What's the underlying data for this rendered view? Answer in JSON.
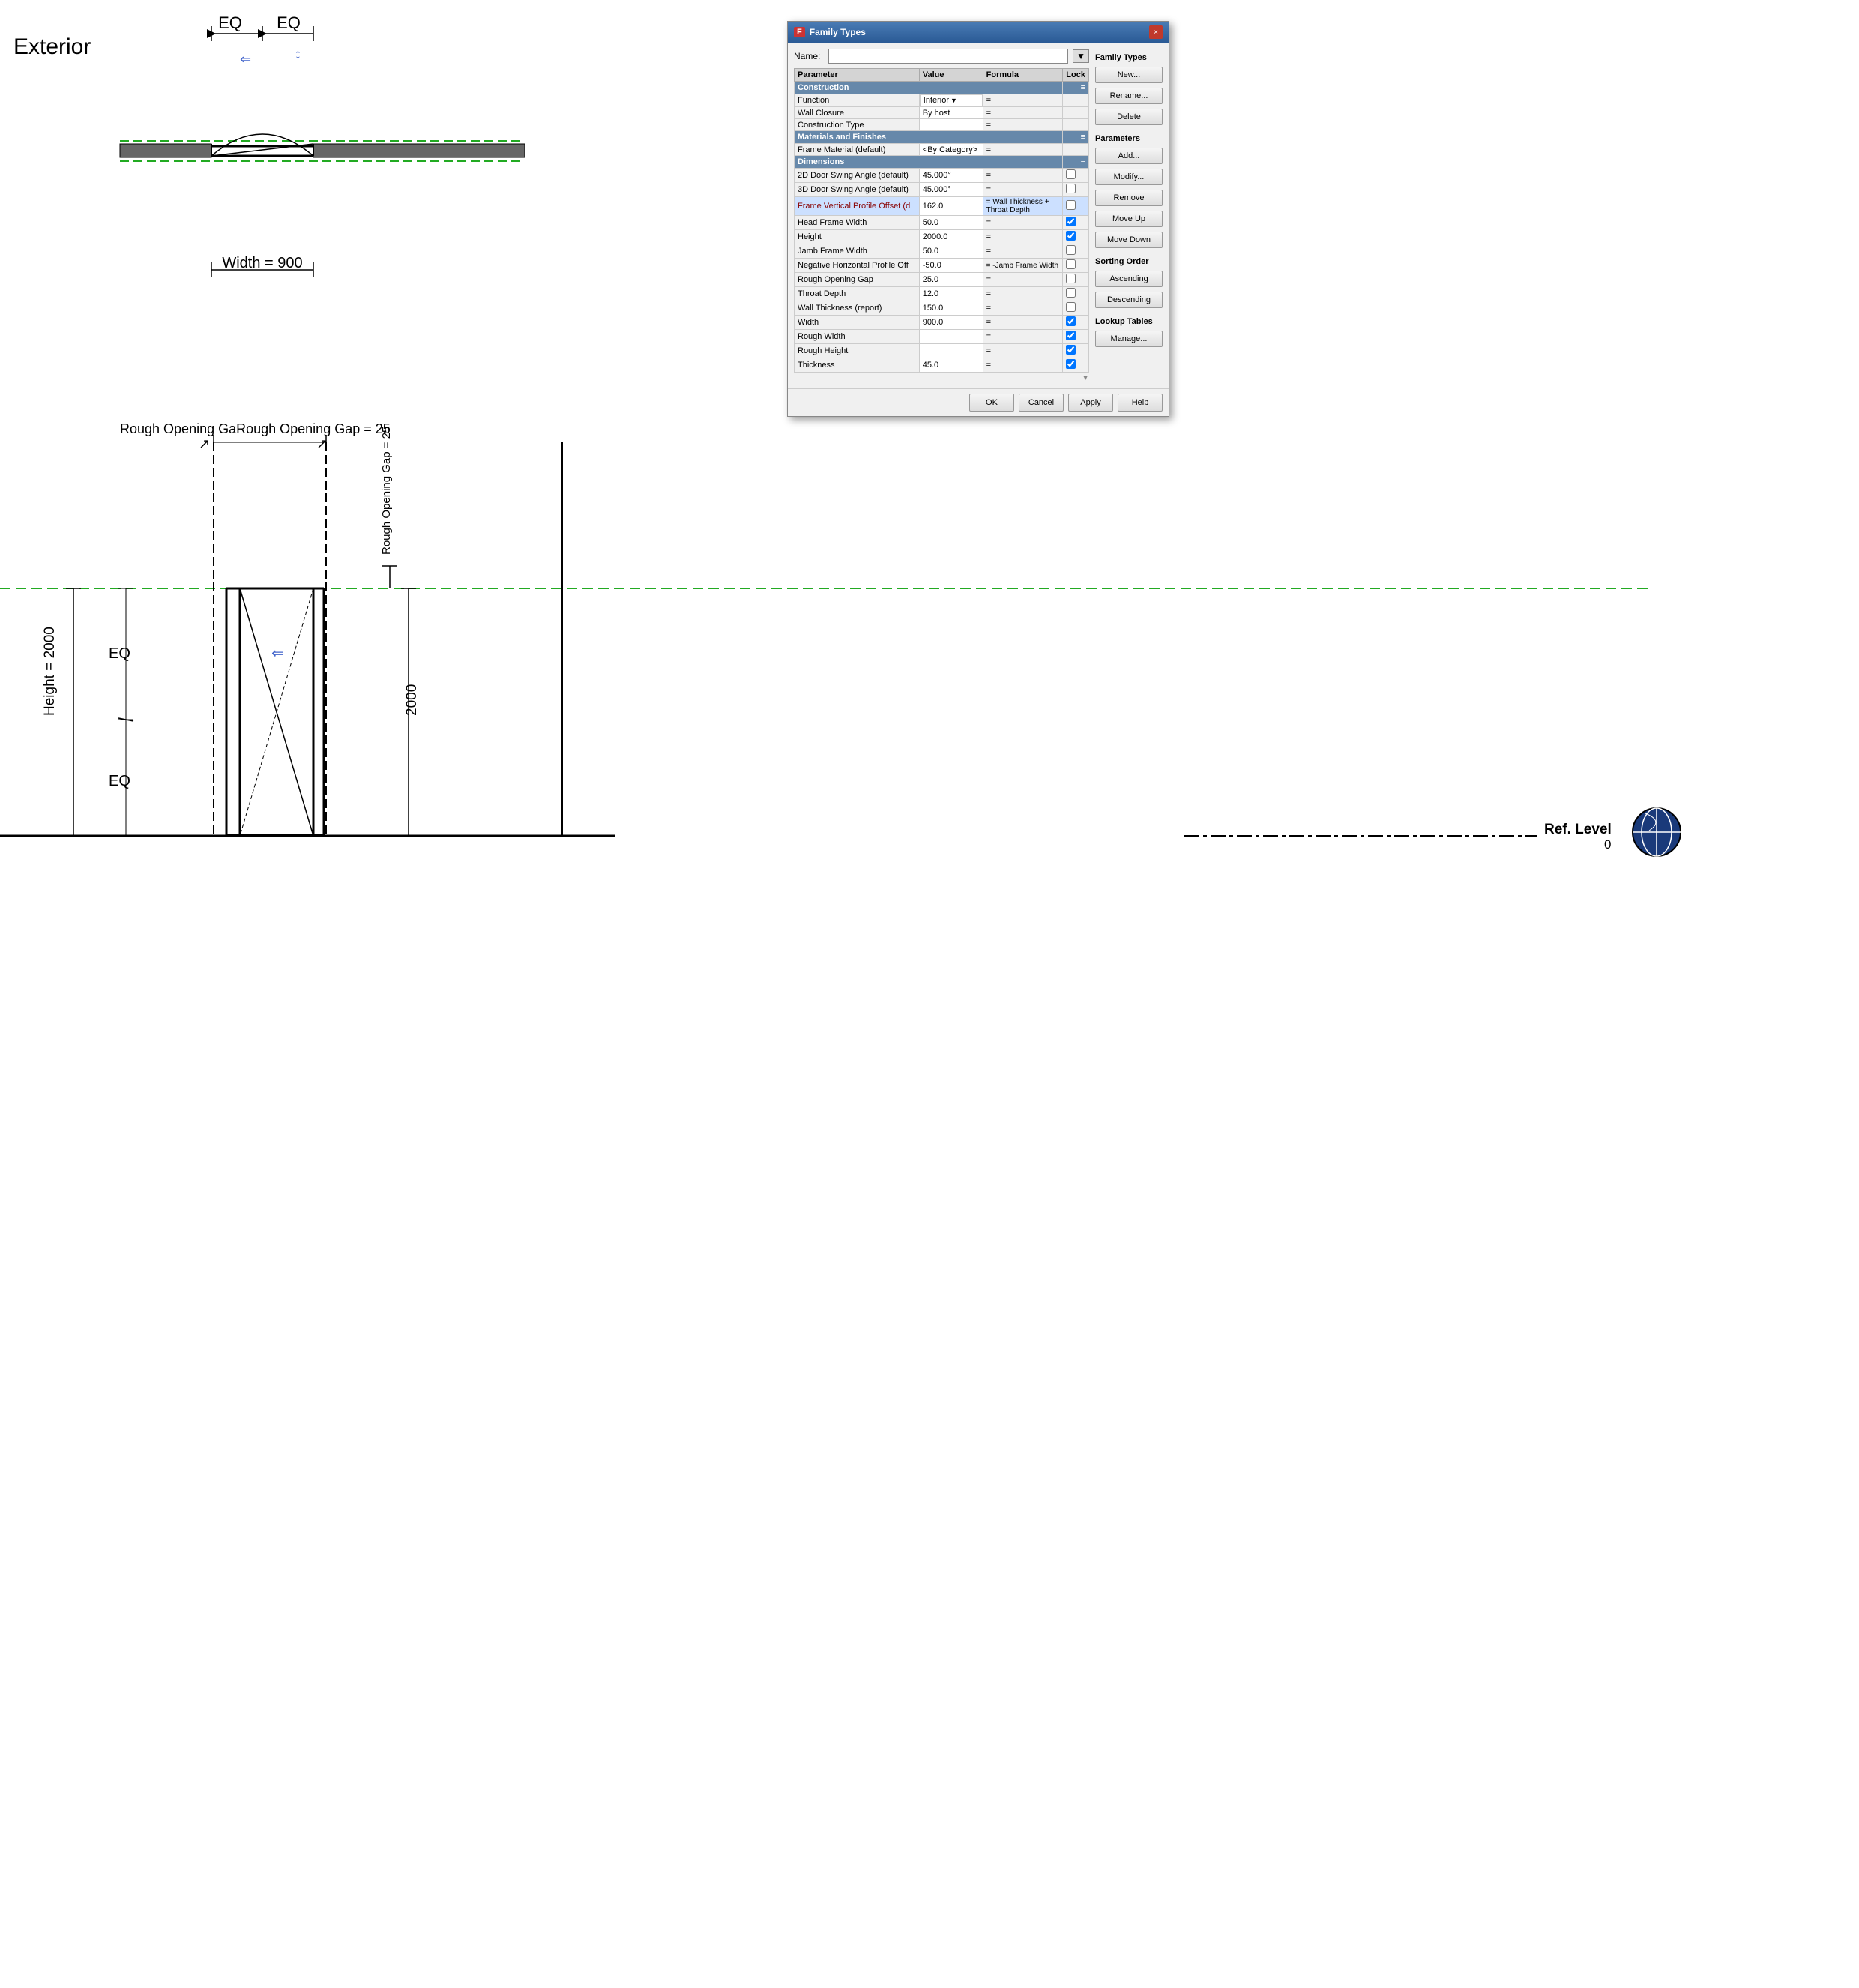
{
  "dialog": {
    "title": "Family Types",
    "title_icon": "F",
    "name_label": "Name:",
    "name_value": "",
    "close_button": "×",
    "family_types_section": "Family Types",
    "buttons": {
      "new": "New...",
      "rename": "Rename...",
      "delete": "Delete",
      "parameters_label": "Parameters",
      "add": "Add...",
      "modify": "Modify...",
      "remove": "Remove",
      "move_up": "Move Up",
      "move_down": "Move Down",
      "sorting_order": "Sorting Order",
      "ascending": "Ascending",
      "descending": "Descending",
      "lookup_tables": "Lookup Tables",
      "manage": "Manage...",
      "ok": "OK",
      "cancel": "Cancel",
      "apply": "Apply",
      "help": "Help"
    },
    "table": {
      "headers": [
        "Parameter",
        "Value",
        "Formula",
        "Lock"
      ],
      "sections": [
        {
          "name": "Construction",
          "rows": [
            {
              "param": "Function",
              "value": "Interior",
              "formula": "=",
              "lock": false,
              "has_dropdown": true
            },
            {
              "param": "Wall Closure",
              "value": "By host",
              "formula": "=",
              "lock": false
            },
            {
              "param": "Construction Type",
              "value": "",
              "formula": "=",
              "lock": false
            }
          ]
        },
        {
          "name": "Materials and Finishes",
          "rows": [
            {
              "param": "Frame Material (default)",
              "value": "<By Category>",
              "formula": "=",
              "lock": false
            }
          ]
        },
        {
          "name": "Dimensions",
          "rows": [
            {
              "param": "2D Door Swing Angle (default)",
              "value": "45.000°",
              "formula": "=",
              "lock": false
            },
            {
              "param": "3D Door Swing Angle (default)",
              "value": "45.000°",
              "formula": "=",
              "lock": false
            },
            {
              "param": "Frame Vertical Profile Offset (d",
              "value": "162.0",
              "formula": "= Wall Thickness + Throat Depth",
              "lock": false,
              "highlighted": true
            },
            {
              "param": "Head Frame Width",
              "value": "50.0",
              "formula": "=",
              "lock": true
            },
            {
              "param": "Height",
              "value": "2000.0",
              "formula": "=",
              "lock": true
            },
            {
              "param": "Jamb Frame Width",
              "value": "50.0",
              "formula": "=",
              "lock": false
            },
            {
              "param": "Negative Horizontal Profile Off",
              "value": "-50.0",
              "formula": "= -Jamb Frame Width",
              "lock": false
            },
            {
              "param": "Rough Opening Gap",
              "value": "25.0",
              "formula": "=",
              "lock": false
            },
            {
              "param": "Throat Depth",
              "value": "12.0",
              "formula": "=",
              "lock": false
            },
            {
              "param": "Wall Thickness (report)",
              "value": "150.0",
              "formula": "=",
              "lock": false
            },
            {
              "param": "Width",
              "value": "900.0",
              "formula": "=",
              "lock": true
            },
            {
              "param": "Rough Width",
              "value": "",
              "formula": "=",
              "lock": true
            },
            {
              "param": "Rough Height",
              "value": "",
              "formula": "=",
              "lock": true
            },
            {
              "param": "Thickness",
              "value": "45.0",
              "formula": "=",
              "lock": true
            }
          ]
        }
      ]
    }
  },
  "drawing": {
    "exterior_label": "Exterior",
    "eq1": "EQ",
    "eq2": "EQ",
    "width_label": "Width = 900",
    "rough_opening_label": "Rough Opening GaRough Opening Gap = 25",
    "height_label": "Height = 2000",
    "eq_lower1": "EQ",
    "eq_lower2": "EQ",
    "value_2000": "2000",
    "rough_right": "Rough Opening Gap = 25",
    "ref_level": "Ref. Level",
    "ref_zero": "0"
  }
}
